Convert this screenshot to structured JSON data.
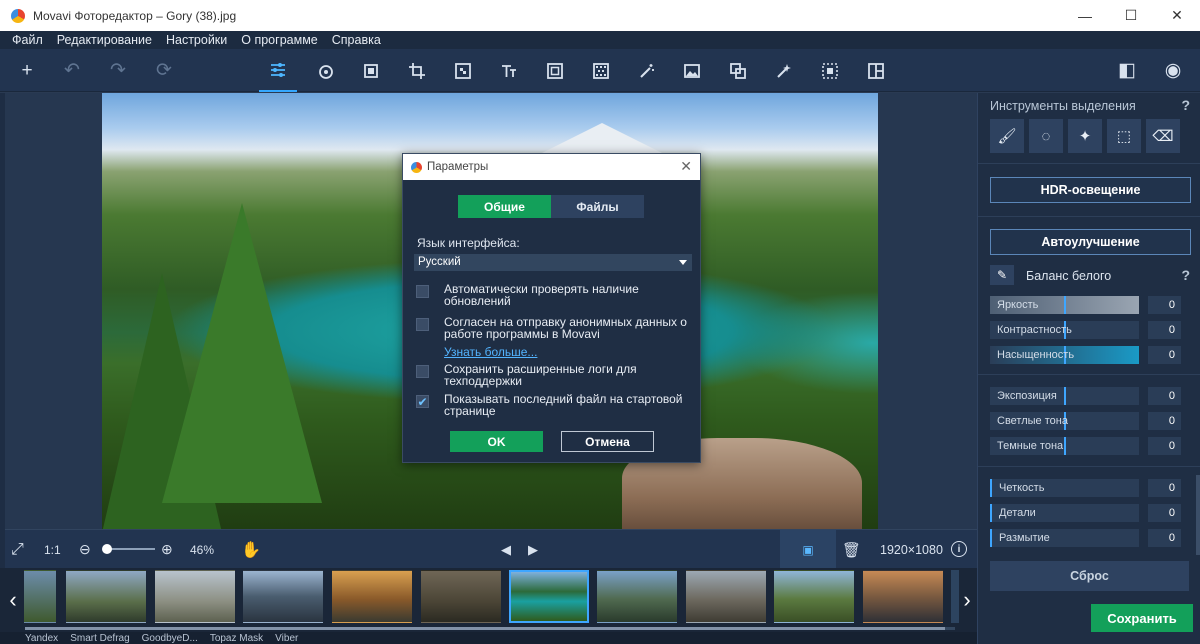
{
  "window": {
    "title": "Movavi Фоторедактор – Gory (38).jpg",
    "minimize": "—",
    "maximize": "☐",
    "close": "✕"
  },
  "menu": [
    "Файл",
    "Редактирование",
    "Настройки",
    "О программе",
    "Справка"
  ],
  "toolbar": {
    "add": "+",
    "undo": "↶",
    "redo": "↷",
    "reset": "⟳",
    "right": {
      "compare": "◧",
      "preview": "◉"
    }
  },
  "dialog": {
    "title": "Параметры",
    "close": "✕",
    "tabs": [
      {
        "label": "Общие",
        "active": true
      },
      {
        "label": "Файлы",
        "active": false
      }
    ],
    "language_label": "Язык интерфейса:",
    "language_value": "Русский",
    "options": [
      {
        "text": "Автоматически проверять наличие обновлений",
        "checked": false
      },
      {
        "text": "Согласен на отправку анонимных данных о работе программы в Movavi",
        "checked": false
      },
      {
        "text": "Сохранить расширенные логи для техподдержки",
        "checked": false
      },
      {
        "text": "Показывать последний файл на стартовой странице",
        "checked": true
      }
    ],
    "link": "Узнать больше...",
    "ok": "OK",
    "cancel": "Отмена"
  },
  "bottombar": {
    "one_to_one": "1:1",
    "zoom": "46%",
    "resolution": "1920×1080",
    "info": "i"
  },
  "taskbar": [
    "Yandex",
    "Smart Defrag",
    "GoodbyeD...",
    "Topaz Mask",
    "Viber"
  ],
  "right_panel": {
    "selection_title": "Инструменты выделения",
    "help": "?",
    "hdr_button": "HDR-освещение",
    "auto_button": "Автоулучшение",
    "white_balance": "Баланс белого",
    "group1": [
      {
        "label": "Яркость",
        "value": "0"
      },
      {
        "label": "Контрастность",
        "value": "0"
      },
      {
        "label": "Насыщенность",
        "value": "0"
      }
    ],
    "group2": [
      {
        "label": "Экспозиция",
        "value": "0"
      },
      {
        "label": "Светлые тона",
        "value": "0"
      },
      {
        "label": "Темные тона",
        "value": "0"
      }
    ],
    "group3": [
      {
        "label": "Четкость",
        "value": "0"
      },
      {
        "label": "Детали",
        "value": "0"
      },
      {
        "label": "Размытие",
        "value": "0"
      }
    ],
    "reset": "Сброс",
    "save": "Сохранить"
  },
  "colors": {
    "accent_green": "#13a05a",
    "accent_blue": "#3ea6ff",
    "panel": "#1f2e44"
  }
}
